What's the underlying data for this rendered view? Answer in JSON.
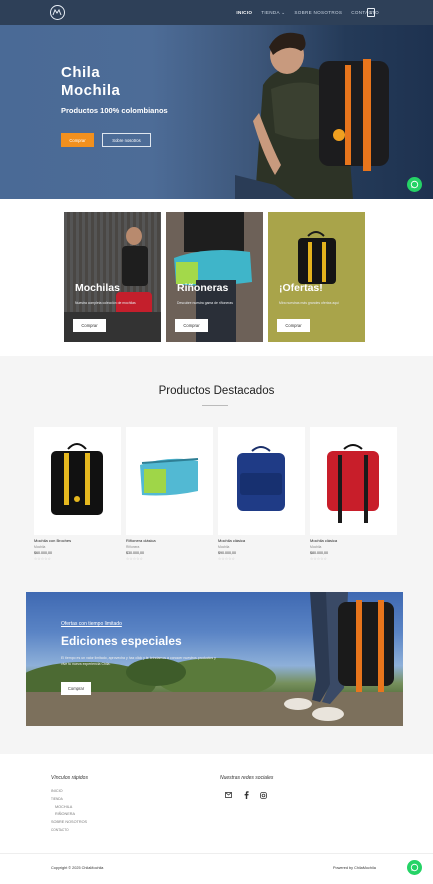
{
  "nav": {
    "links": [
      "INICIO",
      "TIENDA ⌄",
      "SOBRE NOSOTROS",
      "CONTACTO"
    ],
    "cart_count": "0"
  },
  "hero": {
    "title_line1": "Chila",
    "title_line2": "Mochila",
    "subtitle": "Productos 100% colombianos",
    "primary_button": "Comprar",
    "secondary_button": "Sobre nosotros"
  },
  "categories": [
    {
      "title": "Mochilas",
      "desc": "Nuestra completa colección de mochilas",
      "button": "Comprar"
    },
    {
      "title": "Riñoneras",
      "desc": "Descubre nuestra gama de riñoneras",
      "button": "Comprar"
    },
    {
      "title": "¡Ofertas!",
      "desc": "Mira nuestras más grandes ofertas aquí",
      "button": "Comprar"
    }
  ],
  "featured": {
    "title": "Productos Destacados",
    "products": [
      {
        "name": "Mochila con Broches",
        "category": "Mochila",
        "price": "$60.000,00",
        "stars": "☆☆☆☆☆"
      },
      {
        "name": "Riñonera clásica",
        "category": "Riñonera",
        "price": "$30.000,00",
        "stars": "☆☆☆☆☆"
      },
      {
        "name": "Mochila clásica",
        "category": "Mochila",
        "price": "$90.000,00",
        "stars": "☆☆☆☆☆"
      },
      {
        "name": "Mochila clásica",
        "category": "Mochila",
        "price": "$80.000,00",
        "stars": "☆☆☆☆☆"
      }
    ]
  },
  "promo": {
    "eyebrow": "Ofertas con tiempo limitado",
    "title": "Ediciones especiales",
    "desc": "El tiempo es un valor limitado, aprovecha y haz click y te brindamos a conocer nuestros productos y vive tu nueva experiencia Chila.",
    "button": "Comprar"
  },
  "footer": {
    "quick_links_title": "Vínculos rápidos",
    "quick_links": [
      "INICIO",
      "TIENDA",
      "MOCHILA",
      "RIÑONERA",
      "SOBRE NOSOTROS",
      "CONTACTO"
    ],
    "social_title": "Nuestras redes sociales",
    "copyright": "Copyright © 2025 ChilaMochila",
    "powered": "Powered by ChilaMochila"
  },
  "colors": {
    "nav": "#2e4058",
    "accent": "#f2901e",
    "whatsapp": "#25d366"
  }
}
